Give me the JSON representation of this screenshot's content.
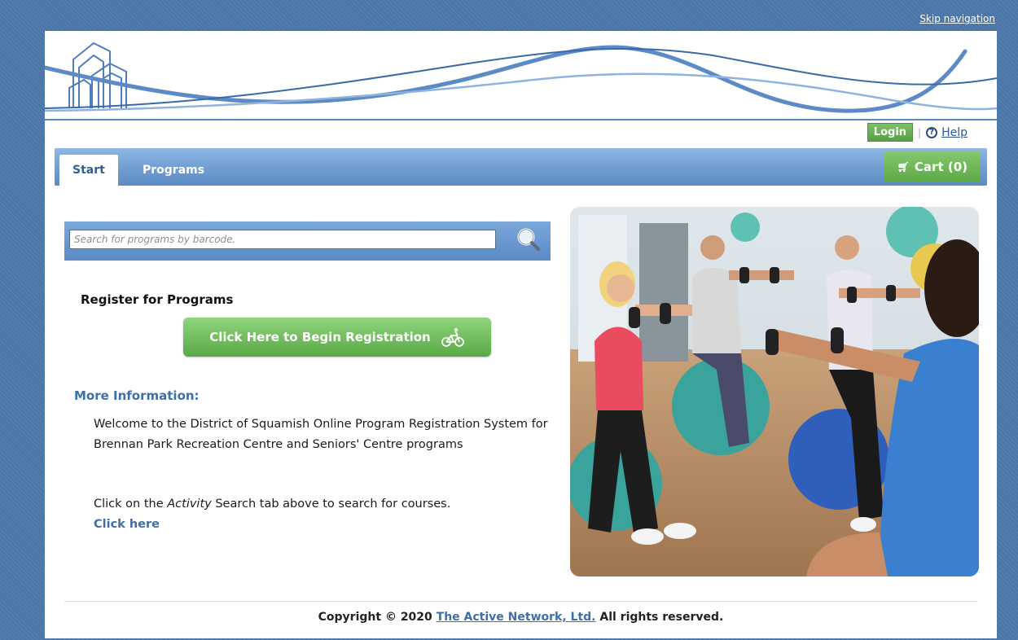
{
  "skip_navigation": "Skip navigation",
  "utility": {
    "login_label": "Login",
    "separator": "|",
    "help_label": "Help"
  },
  "tabs": [
    {
      "label": "Start",
      "active": true
    },
    {
      "label": "Programs",
      "active": false
    }
  ],
  "cart": {
    "label": "Cart (0)",
    "icon": "cart-icon"
  },
  "search": {
    "placeholder": "Search for programs by barcode.",
    "icon": "magnifier-icon"
  },
  "register": {
    "title": "Register for Programs",
    "button_label": "Click Here to Begin Registration",
    "button_icon": "bicycle-icon"
  },
  "more_info": {
    "heading": "More Information:",
    "welcome": "Welcome to the District of Squamish Online Program Registration System for Brennan Park Recreation Centre and Seniors' Centre programs",
    "instruction_before": "Click on the ",
    "instruction_italic": "Activity",
    "instruction_after": " Search tab above to search for courses.",
    "click_here": "Click here"
  },
  "footer": {
    "prefix": "Copyright © 2020 ",
    "link": "The Active Network, Ltd.",
    "suffix": " All rights reserved."
  },
  "colors": {
    "page_border": "#4a76a8",
    "tab_blue": "#6f9dd2",
    "green": "#5ca746",
    "link_blue": "#3e6fa8"
  }
}
